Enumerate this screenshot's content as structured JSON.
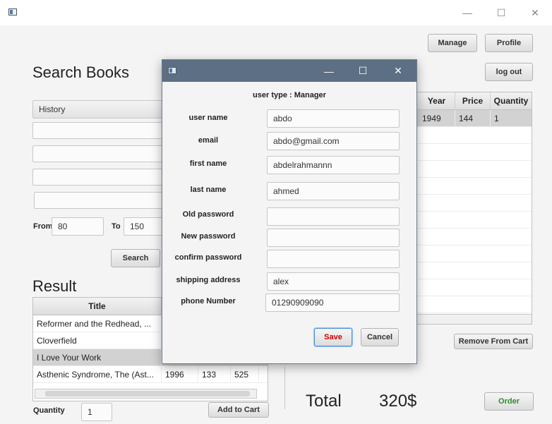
{
  "window": {
    "minimize": "—",
    "maximize": "☐",
    "close": "✕"
  },
  "toolbar": {
    "manage": "Manage",
    "profile": "Profile",
    "logout": "log out"
  },
  "search": {
    "heading": "Search Books",
    "category": "History",
    "from_label": "From",
    "from_value": "80",
    "to_label": "To",
    "to_value": "150",
    "button": "Search"
  },
  "result": {
    "heading": "Result",
    "columns": [
      "Title"
    ],
    "rows": [
      {
        "title": "Reformer and the Redhead, ...",
        "year": "",
        "price": "",
        "qty": ""
      },
      {
        "title": "Cloverfield",
        "year": "",
        "price": "",
        "qty": ""
      },
      {
        "title": "I Love Your Work",
        "year": "",
        "price": "",
        "qty": ""
      },
      {
        "title": "Asthenic Syndrome, The (Ast...",
        "year": "1996",
        "price": "133",
        "qty": "525"
      }
    ],
    "quantity_label": "Quantity",
    "quantity_value": "1",
    "add_button": "Add to Cart"
  },
  "cart": {
    "columns": [
      "Year",
      "Price",
      "Quantity"
    ],
    "rows": [
      {
        "year": "1949",
        "price": "144",
        "qty": "1"
      }
    ],
    "remove_button": "Remove From Cart",
    "total_label": "Total",
    "total_value": "320$",
    "order_button": "Order",
    "order_color": "#2e8b2e"
  },
  "dialog": {
    "user_type": "user type : Manager",
    "fields": [
      {
        "label": "user name",
        "value": "abdo"
      },
      {
        "label": "email",
        "value": "abdo@gmail.com"
      },
      {
        "label": "first name",
        "value": "abdelrahmannn"
      },
      {
        "label": "last name",
        "value": "ahmed"
      },
      {
        "label": "Old password",
        "value": ""
      },
      {
        "label": "New password",
        "value": ""
      },
      {
        "label": "confirm password",
        "value": ""
      },
      {
        "label": "shipping address",
        "value": "alex"
      },
      {
        "label": "phone Number",
        "value": "01290909090"
      }
    ],
    "save": "Save",
    "cancel": "Cancel",
    "save_color": "#cc0000"
  }
}
